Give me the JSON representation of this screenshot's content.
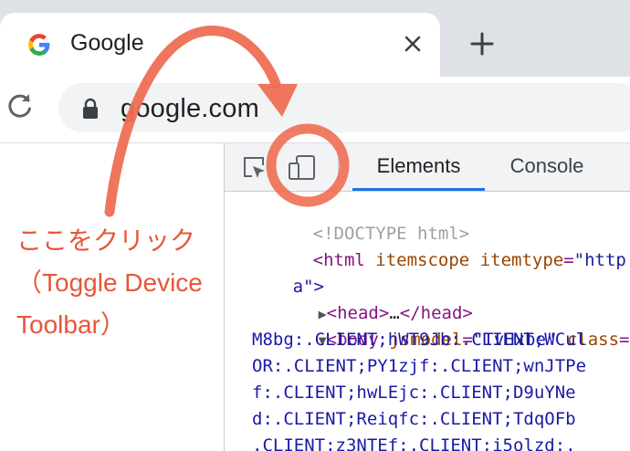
{
  "tab": {
    "title": "Google",
    "close_icon": "close-icon"
  },
  "toolbar": {
    "url": "google.com"
  },
  "devtools": {
    "tabs": [
      {
        "label": "Elements"
      },
      {
        "label": "Console"
      }
    ],
    "code": {
      "doctype": "<!DOCTYPE html>",
      "html_open": "<html",
      "html_attr1": "itemscope",
      "html_attr2": "itemtype",
      "html_val": "\"http:/",
      "html_cont": "a\">",
      "head": "<head>",
      "head_ellipsis": "…",
      "head_close": "</head>",
      "body_open": "<body",
      "body_attr": "jsmodel",
      "body_val": "\"TvHxbe\"",
      "body_attr2": "class",
      "body_val2": "\"",
      "lines": [
        "M8bg:.CLIENT;hWT9Jb:.CLIENT;WCul",
        "OR:.CLIENT;PY1zjf:.CLIENT;wnJTPe",
        "f:.CLIENT;hwLEjc:.CLIENT;D9uYNe",
        "d:.CLIENT;Reiqfc:.CLIENT;TdqOFb",
        ".CLIENT;z3NTEf:.CLIENT;i5olzd:."
      ]
    }
  },
  "annotation": {
    "line1": "ここをクリック",
    "line2": "（Toggle Device",
    "line3": "Toolbar）",
    "color": "#e8553a"
  }
}
